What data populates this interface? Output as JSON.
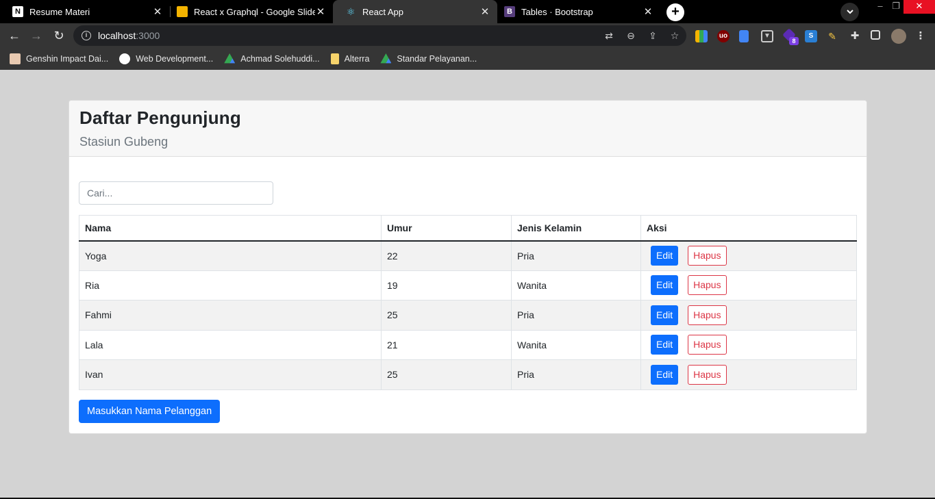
{
  "browser": {
    "tabs": [
      {
        "title": "Resume Materi",
        "icon": "notion-icon",
        "color": "#ffffff"
      },
      {
        "title": "React x Graphql - Google Slides",
        "icon": "slides-icon",
        "color": "#f4b400"
      },
      {
        "title": "React App",
        "icon": "react-icon",
        "color": "#61dafb"
      },
      {
        "title": "Tables · Bootstrap",
        "icon": "bootstrap-icon",
        "color": "#563d7c"
      }
    ],
    "close_glyph": "✕",
    "new_tab_glyph": "+",
    "url_host": "localhost",
    "url_port": ":3000",
    "bookmarks": [
      {
        "label": "Genshin Impact Dai...",
        "icon": "genshin-icon"
      },
      {
        "label": "Web Development...",
        "icon": "dicoding-icon"
      },
      {
        "label": "Achmad Solehuddi...",
        "icon": "drive-icon"
      },
      {
        "label": "Alterra",
        "icon": "folder-icon"
      },
      {
        "label": "Standar Pelayanan...",
        "icon": "drive-icon"
      }
    ],
    "extension_badge": "8"
  },
  "page": {
    "title": "Daftar Pengunjung",
    "subtitle": "Stasiun Gubeng",
    "search_placeholder": "Cari...",
    "table": {
      "headers": [
        "Nama",
        "Umur",
        "Jenis Kelamin",
        "Aksi"
      ],
      "rows": [
        {
          "nama": "Yoga",
          "umur": "22",
          "jk": "Pria"
        },
        {
          "nama": "Ria",
          "umur": "19",
          "jk": "Wanita"
        },
        {
          "nama": "Fahmi",
          "umur": "25",
          "jk": "Pria"
        },
        {
          "nama": "Lala",
          "umur": "21",
          "jk": "Wanita"
        },
        {
          "nama": "Ivan",
          "umur": "25",
          "jk": "Pria"
        }
      ],
      "edit_label": "Edit",
      "delete_label": "Hapus"
    },
    "add_button": "Masukkan Nama Pelanggan",
    "colors": {
      "primary": "#0d6efd",
      "danger": "#dc3545",
      "background": "#d3d3d3"
    }
  }
}
